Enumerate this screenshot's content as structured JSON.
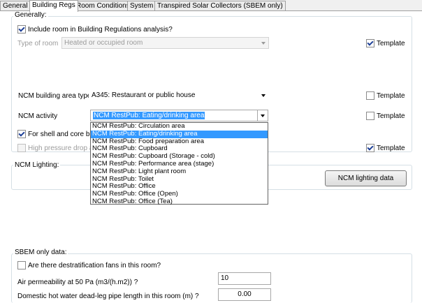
{
  "tabs": [
    "General",
    "Building Regs",
    "Room Conditions",
    "System",
    "Transpired Solar Collectors (SBEM only)"
  ],
  "generally": {
    "title": "Generally:",
    "include_room_label": "Include room in Building Regulations analysis?",
    "include_room_checked": true,
    "type_of_room_label": "Type of room",
    "type_of_room_value": "Heated or occupied room",
    "template_label": "Template"
  },
  "ncm": {
    "building_area_type_label": "NCM building area type",
    "building_area_type_value": "A345: Restaurant or public house",
    "activity_label": "NCM activity",
    "activity_value": "NCM RestPub: Eating/drinking area",
    "template_label": "Template",
    "shell_core_label": "For shell and core buil",
    "high_pressure_label": "High pressure drop air"
  },
  "dropdown_options": [
    "NCM RestPub: Circulation area",
    "NCM RestPub: Eating/drinking area",
    "NCM RestPub: Food preparation area",
    "NCM RestPub: Cupboard",
    "NCM RestPub: Cupboard (Storage - cold)",
    "NCM RestPub: Performance area (stage)",
    "NCM RestPub: Light plant room",
    "NCM RestPub: Toilet",
    "NCM RestPub: Office",
    "NCM RestPub: Office (Open)",
    "NCM RestPub: Office (Tea)"
  ],
  "lighting": {
    "title": "NCM Lighting:",
    "button_label": "NCM lighting data"
  },
  "sbem": {
    "title": "SBEM only data:",
    "destrat_label": "Are there destratification fans in this room?",
    "air_perm_label": "Air permeability at 50 Pa (m3/(h.m2)) ?",
    "air_perm_value": "10",
    "dhw_label": "Domestic hot water dead-leg pipe length in this room (m) ?",
    "dhw_value": "0.00"
  }
}
